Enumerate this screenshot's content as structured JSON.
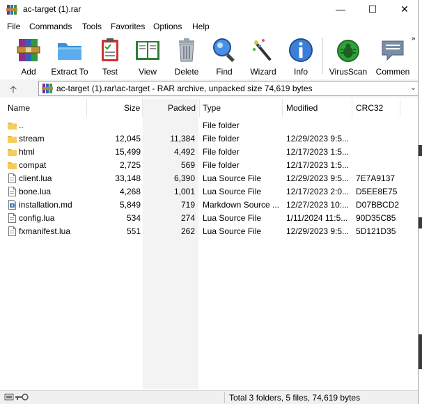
{
  "window": {
    "title": "ac-target (1).rar",
    "controls": {
      "minimize": "—",
      "maximize": "☐",
      "close": "✕"
    }
  },
  "menu": [
    "File",
    "Commands",
    "Tools",
    "Favorites",
    "Options",
    "Help"
  ],
  "toolbar": {
    "buttons": [
      {
        "label": "Add",
        "icon": "add-archive-icon"
      },
      {
        "label": "Extract To",
        "icon": "extract-folder-icon"
      },
      {
        "label": "Test",
        "icon": "test-clipboard-icon"
      },
      {
        "label": "View",
        "icon": "view-book-icon"
      },
      {
        "label": "Delete",
        "icon": "trash-icon"
      },
      {
        "label": "Find",
        "icon": "magnifier-icon"
      },
      {
        "label": "Wizard",
        "icon": "wand-icon"
      },
      {
        "label": "Info",
        "icon": "info-icon"
      },
      {
        "label": "VirusScan",
        "icon": "bug-icon"
      },
      {
        "label": "Commen",
        "icon": "comment-icon"
      }
    ],
    "more": "»"
  },
  "address": {
    "text": "ac-target (1).rar\\ac-target - RAR archive, unpacked size 74,619 bytes",
    "dropdown": "⌄",
    "up": "🡡"
  },
  "columns": {
    "name": "Name",
    "size": "Size",
    "packed": "Packed",
    "type": "Type",
    "modified": "Modified",
    "crc": "CRC32"
  },
  "files": [
    {
      "name": "..",
      "size": "",
      "packed": "",
      "type": "File folder",
      "modified": "",
      "crc": "",
      "icon": "folder"
    },
    {
      "name": "stream",
      "size": "12,045",
      "packed": "11,384",
      "type": "File folder",
      "modified": "12/29/2023 9:5...",
      "crc": "",
      "icon": "folder"
    },
    {
      "name": "html",
      "size": "15,499",
      "packed": "4,492",
      "type": "File folder",
      "modified": "12/17/2023 1:5...",
      "crc": "",
      "icon": "folder"
    },
    {
      "name": "compat",
      "size": "2,725",
      "packed": "569",
      "type": "File folder",
      "modified": "12/17/2023 1:5...",
      "crc": "",
      "icon": "folder"
    },
    {
      "name": "client.lua",
      "size": "33,148",
      "packed": "6,390",
      "type": "Lua Source File",
      "modified": "12/29/2023 9:5...",
      "crc": "7E7A9137",
      "icon": "file"
    },
    {
      "name": "bone.lua",
      "size": "4,268",
      "packed": "1,001",
      "type": "Lua Source File",
      "modified": "12/17/2023 2:0...",
      "crc": "D5EE8E75",
      "icon": "file"
    },
    {
      "name": "installation.md",
      "size": "5,849",
      "packed": "719",
      "type": "Markdown Source ...",
      "modified": "12/27/2023 10:...",
      "crc": "D07BBCD2",
      "icon": "md"
    },
    {
      "name": "config.lua",
      "size": "534",
      "packed": "274",
      "type": "Lua Source File",
      "modified": "1/11/2024 11:5...",
      "crc": "90D35C85",
      "icon": "file"
    },
    {
      "name": "fxmanifest.lua",
      "size": "551",
      "packed": "262",
      "type": "Lua Source File",
      "modified": "12/29/2023 9:5...",
      "crc": "5D121D35",
      "icon": "file"
    }
  ],
  "status": {
    "summary": "Total 3 folders, 5 files, 74,619 bytes"
  },
  "colors": {
    "folder": "#f2c14a",
    "accent": "#0a64c8",
    "sorted_column": "#f3f3f3"
  }
}
